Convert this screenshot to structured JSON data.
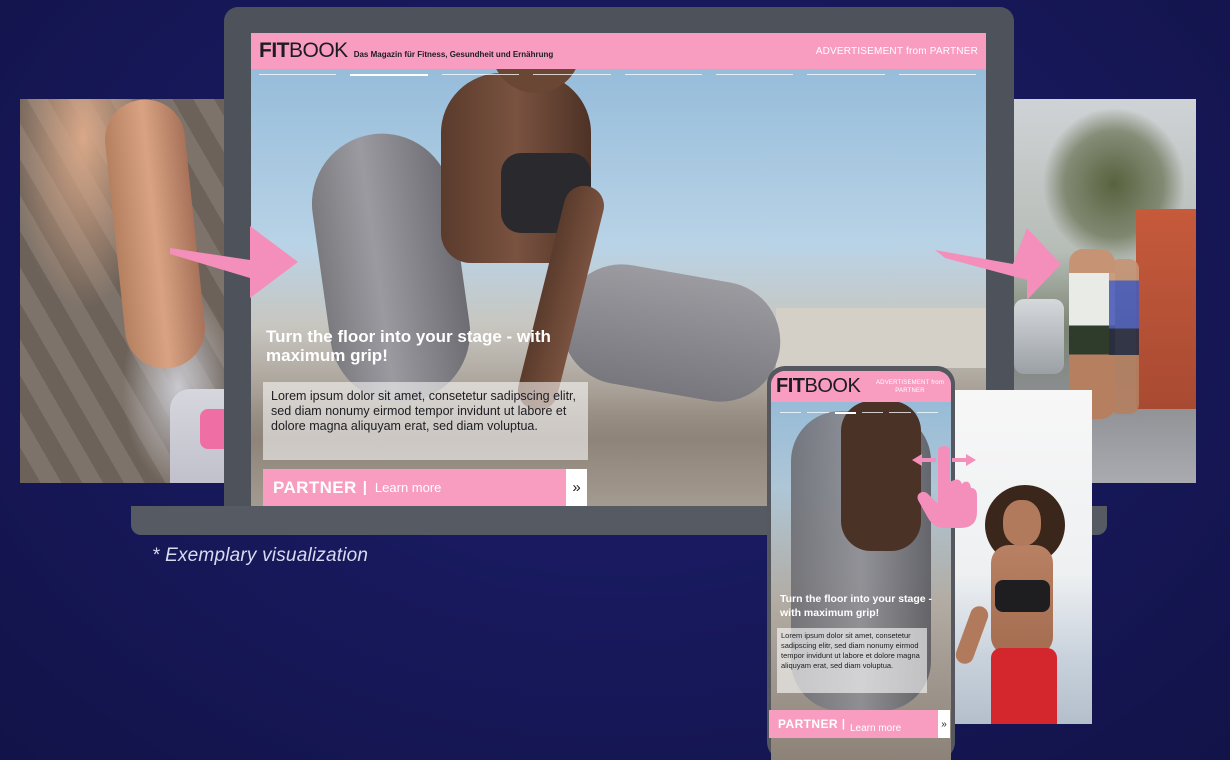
{
  "laptop": {
    "logo_fit": "FIT",
    "logo_book": "BOOK",
    "tagline": "Das Magazin für Fitness, Gesundheit und Ernährung",
    "ad_label": "ADVERTISEMENT from PARTNER",
    "headline": "Turn the floor into your stage - with maximum grip!",
    "body": "Lorem ipsum dolor sit amet, consetetur sadipscing elitr, sed diam nonumy eirmod tempor invidunt ut labore et dolore magna aliquyam erat, sed diam voluptua.",
    "cta_partner": "PARTNER",
    "cta_separator": "|",
    "cta_learn_more": "Learn more",
    "cta_arrow": "»",
    "progress_active_index": 1
  },
  "phone": {
    "logo_fit": "FIT",
    "logo_book": "BOOK",
    "ad_label": "ADVERTISEMENT from PARTNER",
    "headline": "Turn the floor into your stage - with maximum grip!",
    "body": "Lorem ipsum dolor sit amet, consetetur sadipscing elitr, sed diam nonumy eirmod tempor invidunt ut labore et dolore magna aliquyam erat, sed diam voluptua.",
    "cta_partner": "PARTNER",
    "cta_separator": "|",
    "cta_learn_more": "Learn more",
    "cta_arrow": "»",
    "progress_active_index": 2
  },
  "footnote": "* Exemplary visualization",
  "icons": {
    "swipe": "swipe-hand-icon",
    "next_arrows": "arrow-right-icon"
  },
  "colors": {
    "background": "#17185a",
    "brand_pink": "#f89dc0",
    "device_frame": "#55585f"
  }
}
